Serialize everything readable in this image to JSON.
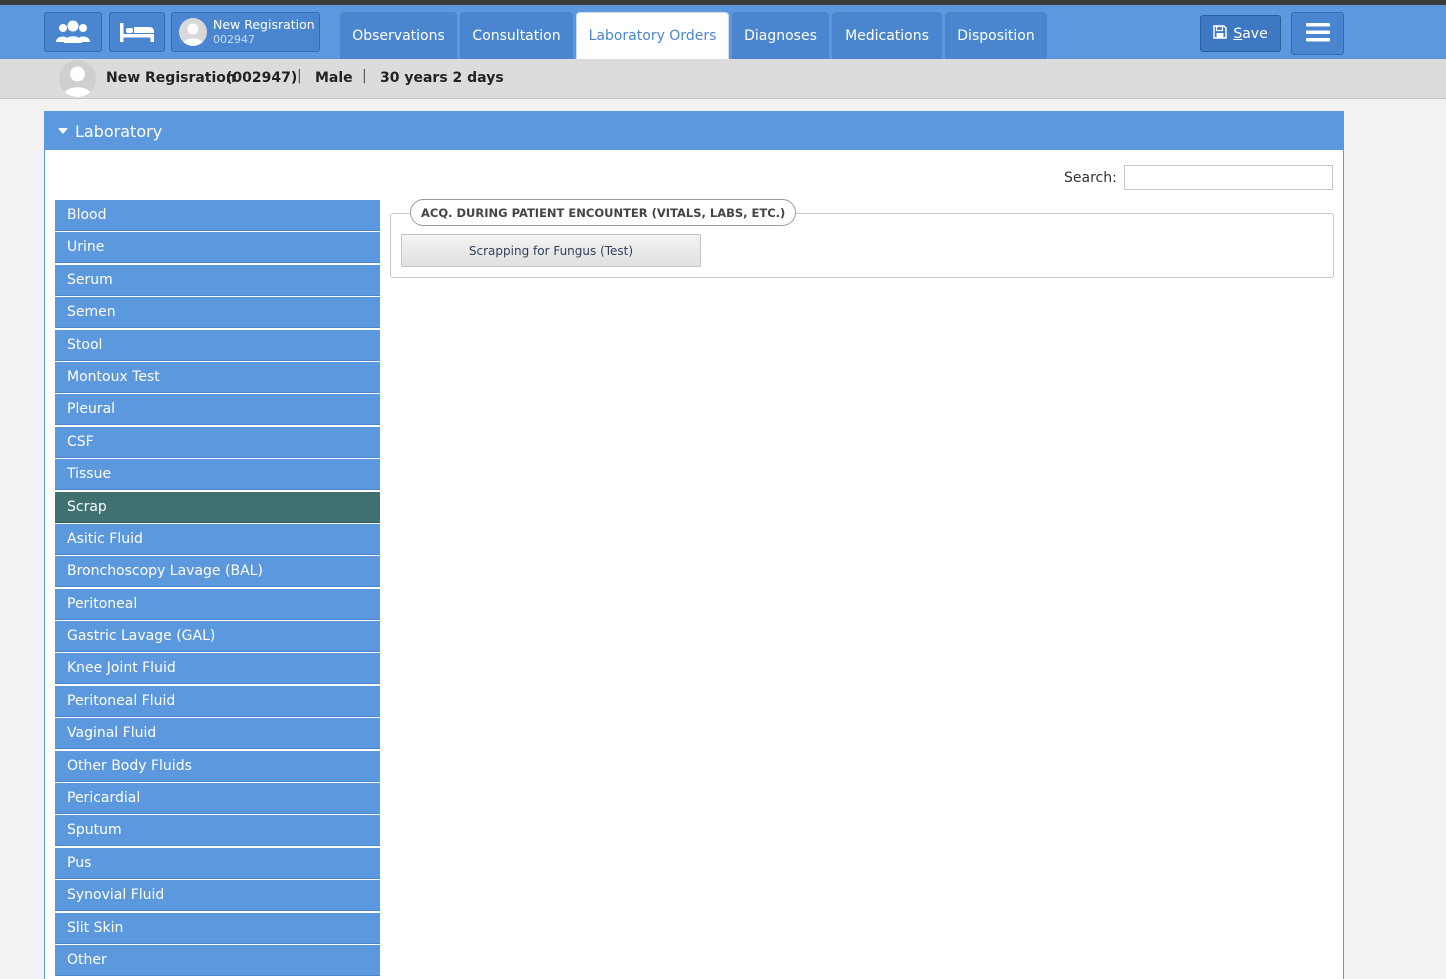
{
  "header": {
    "patient_name": "New Regisration",
    "patient_id": "002947",
    "tabs": [
      {
        "label": "Observations",
        "active": false
      },
      {
        "label": "Consultation",
        "active": false
      },
      {
        "label": "Laboratory Orders",
        "active": true
      },
      {
        "label": "Diagnoses",
        "active": false
      },
      {
        "label": "Medications",
        "active": false
      },
      {
        "label": "Disposition",
        "active": false
      }
    ],
    "save_prefix": "S",
    "save_rest": "ave"
  },
  "info": {
    "name": "New Regisration",
    "id": "(002947)",
    "gender": "Male",
    "age": "30 years 2 days",
    "separator": "|"
  },
  "panel": {
    "title": "Laboratory",
    "search_label": "Search:",
    "search_value": "",
    "categories": [
      "Blood",
      "Urine",
      "Serum",
      "Semen",
      "Stool",
      "Montoux Test",
      "Pleural",
      "CSF",
      "Tissue",
      "Scrap",
      "Asitic Fluid",
      "Bronchoscopy Lavage (BAL)",
      "Peritoneal",
      "Gastric Lavage (GAL)",
      "Knee Joint Fluid",
      "Peritoneal Fluid",
      "Vaginal Fluid",
      "Other Body Fluids",
      "Pericardial",
      "Sputum",
      "Pus",
      "Synovial Fluid",
      "Slit Skin",
      "Other"
    ],
    "selected_category": "Scrap",
    "group_legend": "ACQ. DURING PATIENT ENCOUNTER (VITALS, LABS, ETC.)",
    "tests": [
      "Scrapping for Fungus (Test)"
    ]
  },
  "colors": {
    "primary": "#5b98dd",
    "primary_dark": "#4a86cf",
    "selected": "#3e7170"
  }
}
